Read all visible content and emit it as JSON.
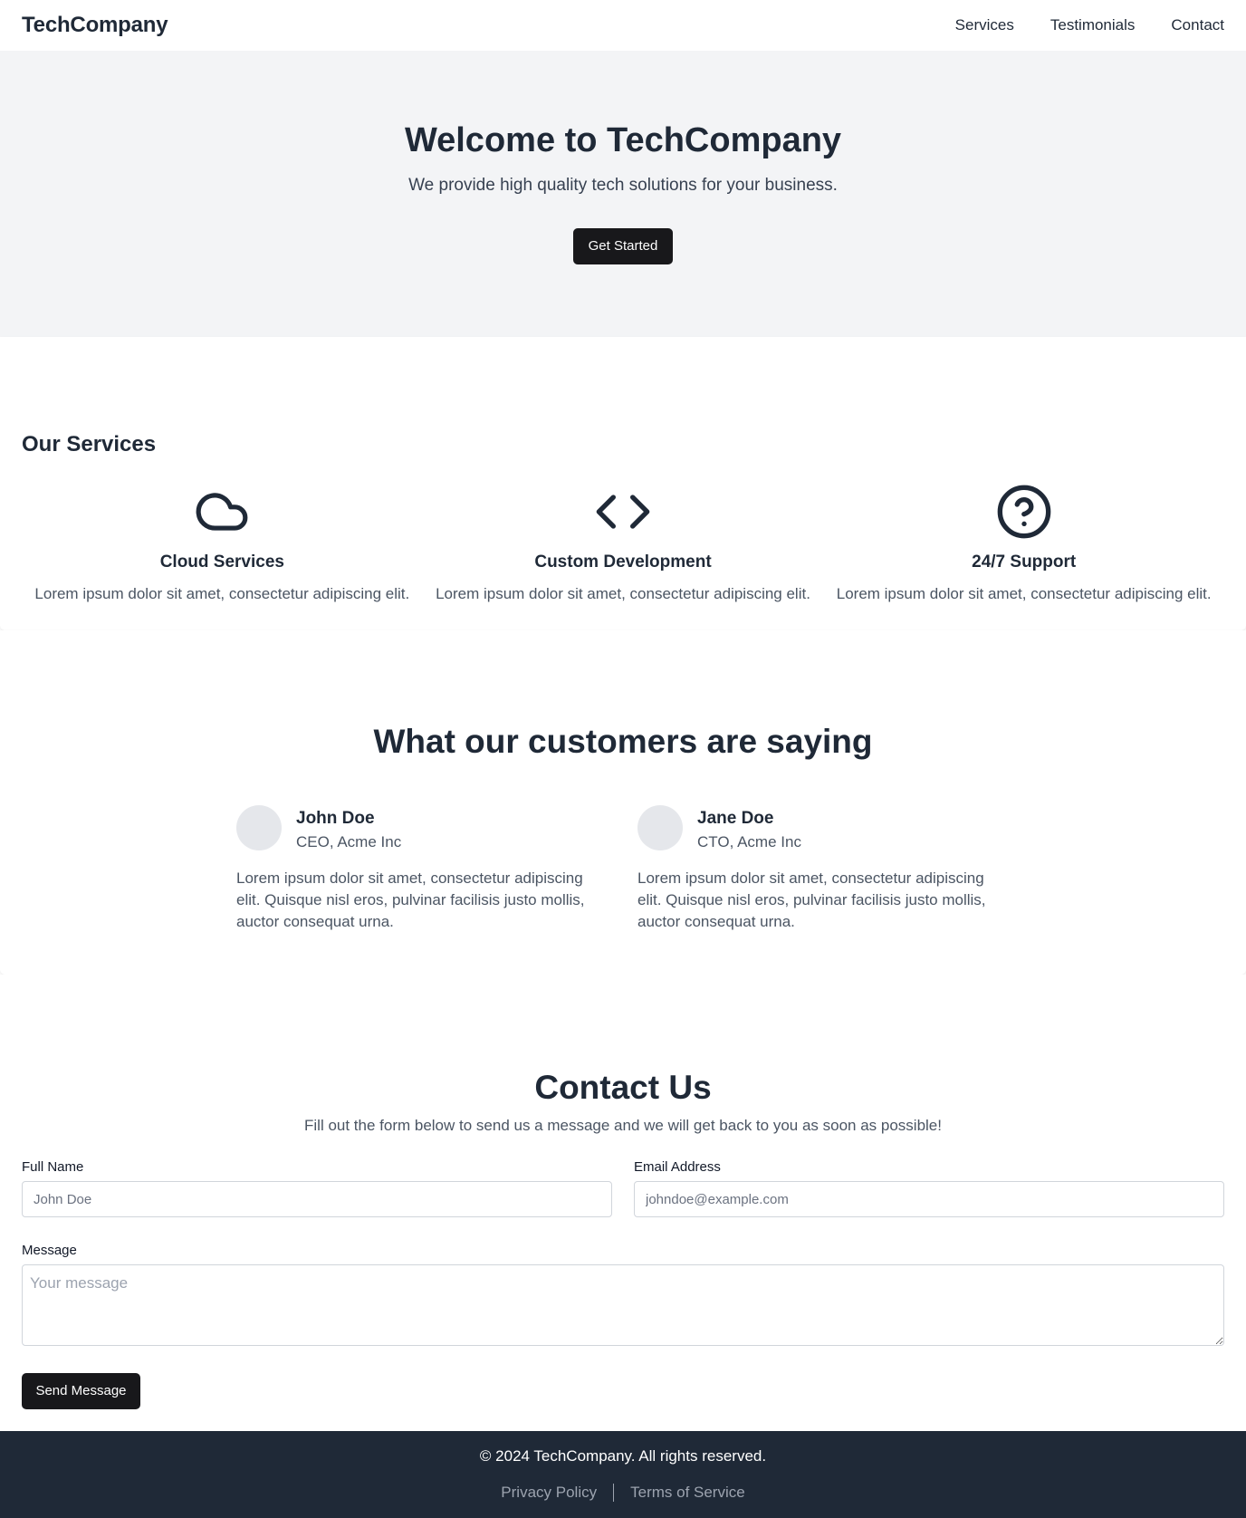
{
  "nav": {
    "brand": "TechCompany",
    "links": [
      "Services",
      "Testimonials",
      "Contact"
    ]
  },
  "hero": {
    "title": "Welcome to TechCompany",
    "subtitle": "We provide high quality tech solutions for your business.",
    "cta": "Get Started"
  },
  "services": {
    "heading": "Our Services",
    "items": [
      {
        "icon": "cloud-icon",
        "title": "Cloud Services",
        "desc": "Lorem ipsum dolor sit amet, consectetur adipiscing elit."
      },
      {
        "icon": "code-icon",
        "title": "Custom Development",
        "desc": "Lorem ipsum dolor sit amet, consectetur adipiscing elit."
      },
      {
        "icon": "help-circle-icon",
        "title": "24/7 Support",
        "desc": "Lorem ipsum dolor sit amet, consectetur adipiscing elit."
      }
    ]
  },
  "testimonials": {
    "heading": "What our customers are saying",
    "items": [
      {
        "name": "John Doe",
        "role": "CEO, Acme Inc",
        "quote": "Lorem ipsum dolor sit amet, consectetur adipiscing elit. Quisque nisl eros, pulvinar facilisis justo mollis, auctor consequat urna."
      },
      {
        "name": "Jane Doe",
        "role": "CTO, Acme Inc",
        "quote": "Lorem ipsum dolor sit amet, consectetur adipiscing elit. Quisque nisl eros, pulvinar facilisis justo mollis, auctor consequat urna."
      }
    ]
  },
  "contact": {
    "heading": "Contact Us",
    "subtitle": "Fill out the form below to send us a message and we will get back to you as soon as possible!",
    "name_label": "Full Name",
    "name_placeholder": "John Doe",
    "email_label": "Email Address",
    "email_placeholder": "johndoe@example.com",
    "message_label": "Message",
    "message_placeholder": "Your message",
    "submit": "Send Message"
  },
  "footer": {
    "copyright": "© 2024 TechCompany. All rights reserved.",
    "links": [
      "Privacy Policy",
      "Terms of Service"
    ]
  },
  "colors": {
    "text": "#1f2937",
    "hero_bg": "#f3f4f6",
    "button_bg": "#18181b",
    "footer_bg": "#1f2937",
    "muted": "#4b5563"
  }
}
